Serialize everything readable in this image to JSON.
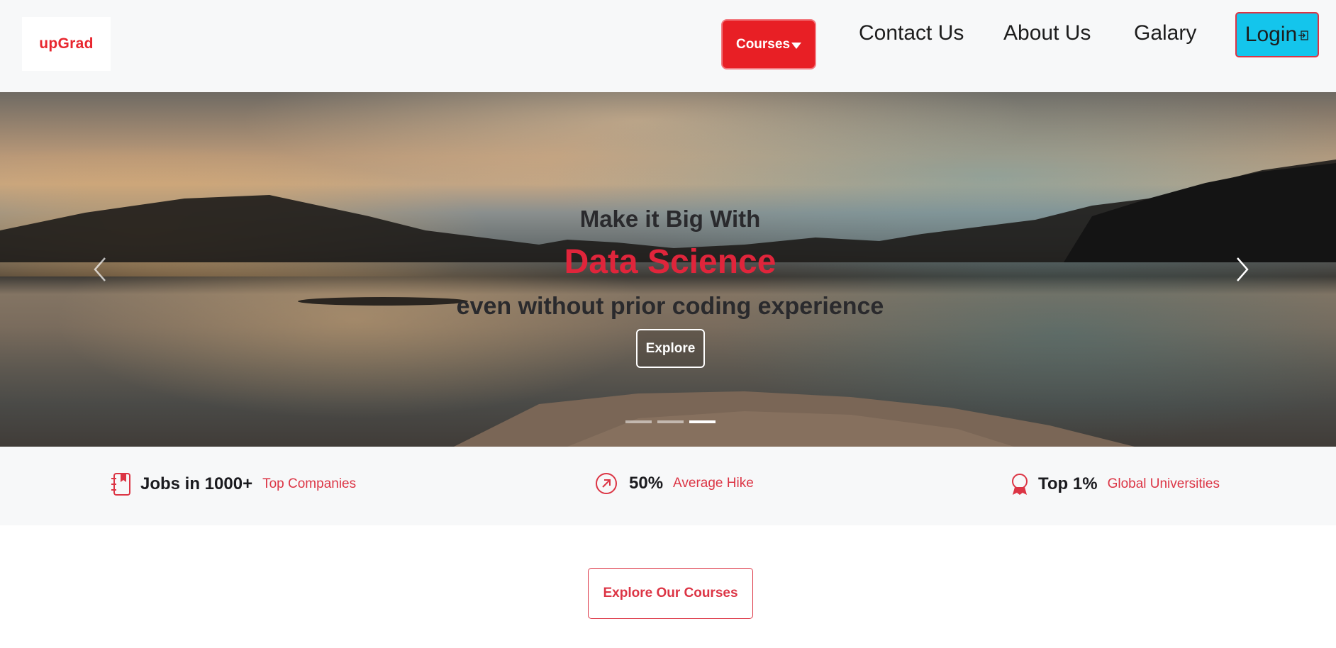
{
  "navbar": {
    "logo_text": "upGrad",
    "courses_label": "Courses",
    "links": [
      "Contact Us",
      "About Us",
      "Galary"
    ],
    "login_label": "Login",
    "colors": {
      "courses_bg": "#e81f25",
      "login_bg": "#14c5ec",
      "brand_red": "#e8262e"
    }
  },
  "hero": {
    "line1": "Make it Big With",
    "line2": "Data Science",
    "line3": "even without prior coding experience",
    "explore_label": "Explore",
    "prev_icon": "chevron-left-icon",
    "next_icon": "chevron-right-icon",
    "slide_count": 3,
    "active_slide": 3
  },
  "stats": [
    {
      "icon": "jobs-book-icon",
      "value": "Jobs in 1000+",
      "label": "Top Companies"
    },
    {
      "icon": "arrow-up-right-circle-icon",
      "value": "50%",
      "label": "Average Hike"
    },
    {
      "icon": "award-icon",
      "value": "Top 1%",
      "label": "Global Universities"
    }
  ],
  "explore_courses_label": "Explore Our Courses",
  "accent_color": "#dc3545"
}
